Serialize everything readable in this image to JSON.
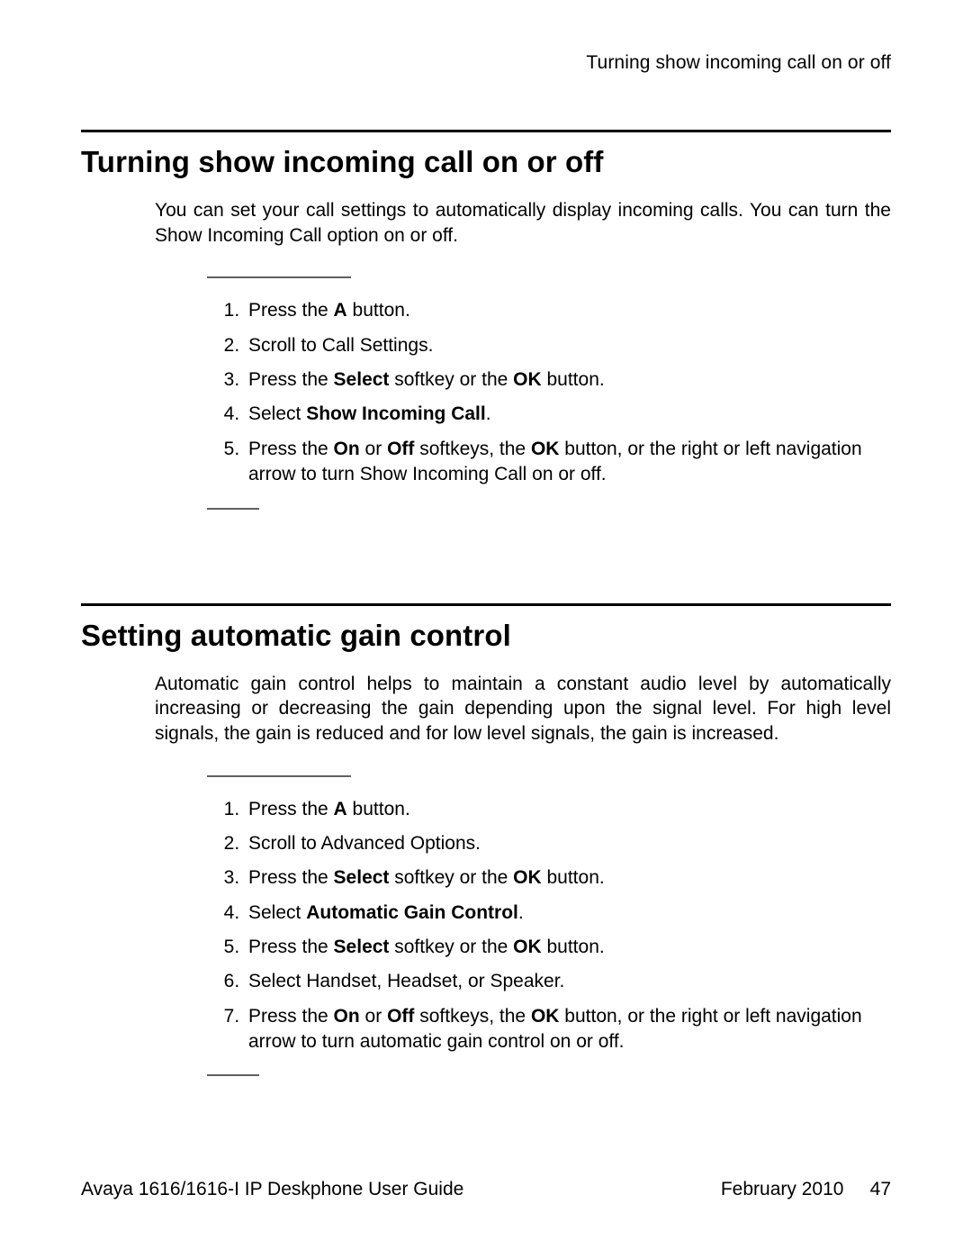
{
  "header": {
    "running_title": "Turning show incoming call on or off"
  },
  "sections": [
    {
      "title": "Turning show incoming call on or off",
      "intro": "You can set your call settings to automatically display incoming calls. You can turn the Show Incoming Call option on or off.",
      "steps": [
        [
          {
            "t": "Press the "
          },
          {
            "t": "A",
            "b": true
          },
          {
            "t": " button."
          }
        ],
        [
          {
            "t": "Scroll to Call Settings."
          }
        ],
        [
          {
            "t": "Press the "
          },
          {
            "t": "Select",
            "b": true
          },
          {
            "t": " softkey or the "
          },
          {
            "t": "OK",
            "b": true
          },
          {
            "t": " button."
          }
        ],
        [
          {
            "t": "Select "
          },
          {
            "t": "Show Incoming Call",
            "b": true
          },
          {
            "t": "."
          }
        ],
        [
          {
            "t": "Press the "
          },
          {
            "t": "On",
            "b": true
          },
          {
            "t": " or "
          },
          {
            "t": "Off",
            "b": true
          },
          {
            "t": " softkeys, the "
          },
          {
            "t": "OK",
            "b": true
          },
          {
            "t": " button, or the right or left navigation arrow to turn Show Incoming Call on or off."
          }
        ]
      ]
    },
    {
      "title": "Setting automatic gain control",
      "intro": "Automatic gain control helps to maintain a constant audio level by automatically increasing or decreasing the gain depending upon the signal level. For high level signals, the gain is reduced and for low level signals, the gain is increased.",
      "steps": [
        [
          {
            "t": "Press the "
          },
          {
            "t": "A",
            "b": true
          },
          {
            "t": " button."
          }
        ],
        [
          {
            "t": "Scroll to Advanced Options."
          }
        ],
        [
          {
            "t": "Press the "
          },
          {
            "t": "Select",
            "b": true
          },
          {
            "t": " softkey or the "
          },
          {
            "t": "OK",
            "b": true
          },
          {
            "t": " button."
          }
        ],
        [
          {
            "t": "Select "
          },
          {
            "t": "Automatic Gain Control",
            "b": true
          },
          {
            "t": "."
          }
        ],
        [
          {
            "t": "Press the "
          },
          {
            "t": "Select",
            "b": true
          },
          {
            "t": " softkey or the "
          },
          {
            "t": "OK",
            "b": true
          },
          {
            "t": " button."
          }
        ],
        [
          {
            "t": "Select Handset, Headset, or Speaker."
          }
        ],
        [
          {
            "t": "Press the "
          },
          {
            "t": "On",
            "b": true
          },
          {
            "t": " or "
          },
          {
            "t": "Off",
            "b": true
          },
          {
            "t": " softkeys, the "
          },
          {
            "t": "OK",
            "b": true
          },
          {
            "t": " button, or the right or left navigation arrow to turn automatic gain control on or off."
          }
        ]
      ]
    }
  ],
  "footer": {
    "left": "Avaya 1616/1616-I IP Deskphone User Guide",
    "right_date": "February 2010",
    "right_page": "47"
  }
}
